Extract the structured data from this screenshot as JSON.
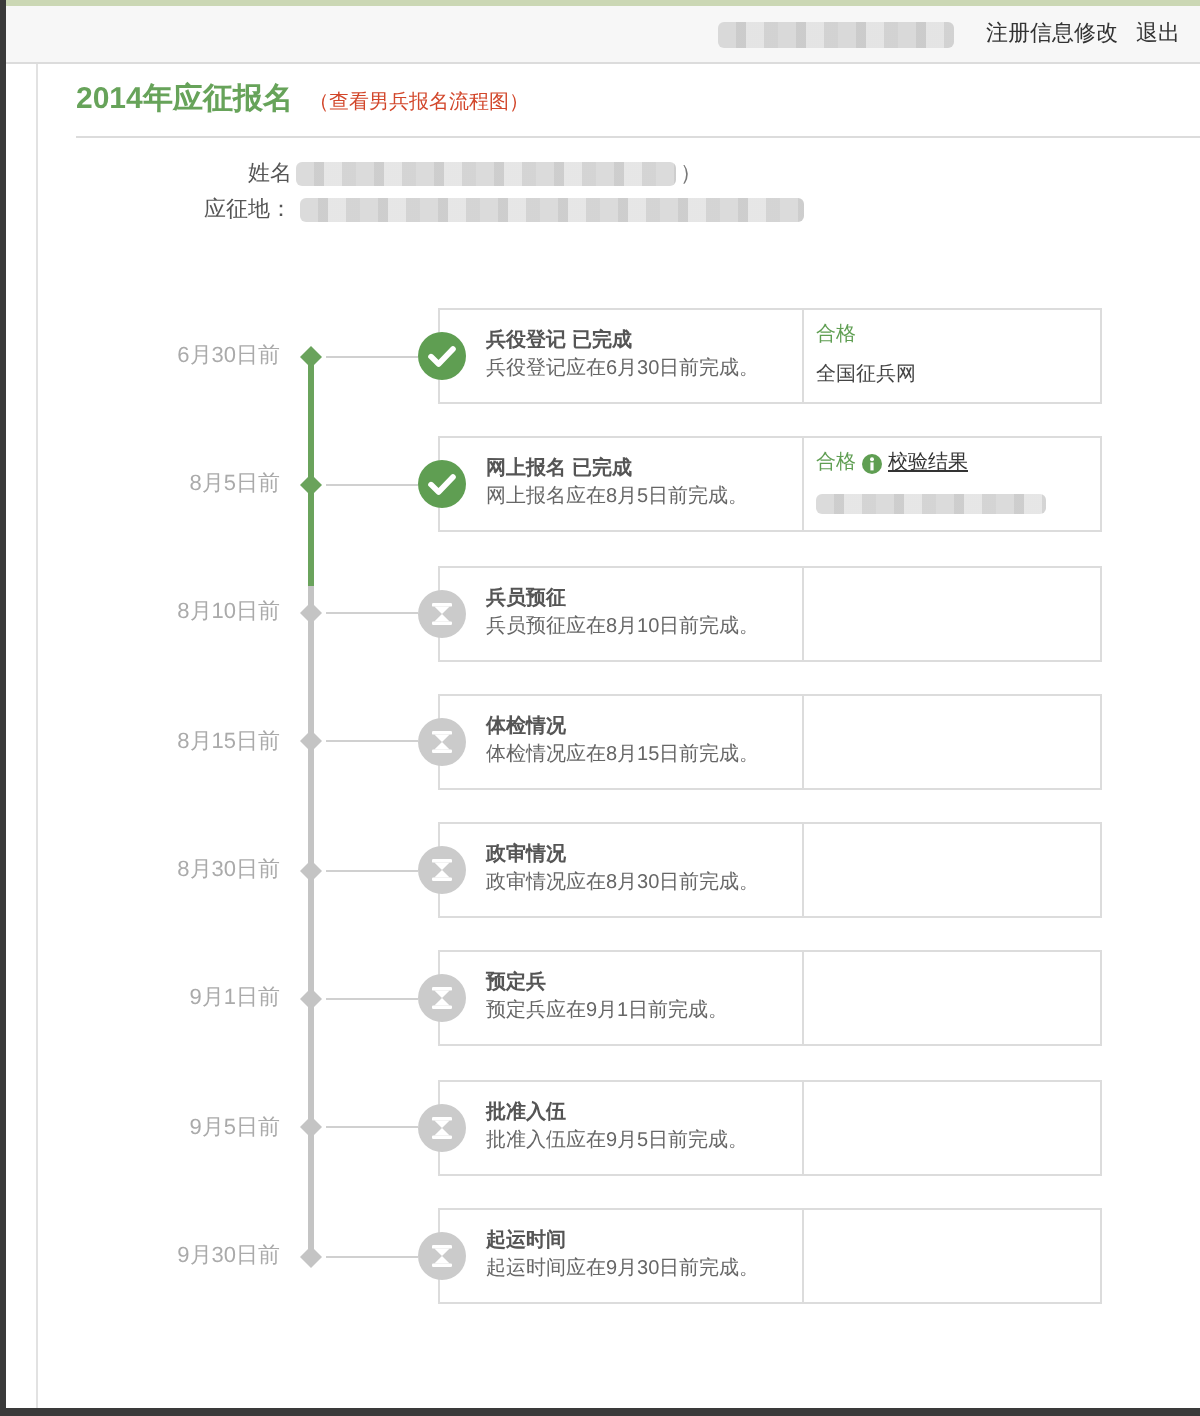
{
  "header": {
    "user_blurred": true,
    "links": [
      "注册信息修改",
      "退出"
    ]
  },
  "page": {
    "title": "2014年应征报名",
    "flow_link": "（查看男兵报名流程图）"
  },
  "applicant": [
    {
      "label": "姓名",
      "blurred": true,
      "suffix": "）"
    },
    {
      "label": "应征地：",
      "blurred": true
    }
  ],
  "steps": [
    {
      "deadline": "6月30日前",
      "done": true,
      "title": "兵役登记 已完成",
      "desc": "兵役登记应在6月30日前完成。",
      "result": {
        "status": "合格",
        "detail": "全国征兵网"
      }
    },
    {
      "deadline": "8月5日前",
      "done": true,
      "title": "网上报名 已完成",
      "desc": "网上报名应在8月5日前完成。",
      "result": {
        "status": "合格",
        "info": true,
        "link": "校验结果",
        "detail_blurred": true
      }
    },
    {
      "deadline": "8月10日前",
      "done": false,
      "title": "兵员预征",
      "desc": "兵员预征应在8月10日前完成。"
    },
    {
      "deadline": "8月15日前",
      "done": false,
      "title": "体检情况",
      "desc": "体检情况应在8月15日前完成。"
    },
    {
      "deadline": "8月30日前",
      "done": false,
      "title": "政审情况",
      "desc": "政审情况应在8月30日前完成。"
    },
    {
      "deadline": "9月1日前",
      "done": false,
      "title": "预定兵",
      "desc": "预定兵应在9月1日前完成。"
    },
    {
      "deadline": "9月5日前",
      "done": false,
      "title": "批准入伍",
      "desc": "批准入伍应在9月5日前完成。"
    },
    {
      "deadline": "9月30日前",
      "done": false,
      "title": "起运时间",
      "desc": "起运时间应在9月30日前完成。"
    }
  ]
}
